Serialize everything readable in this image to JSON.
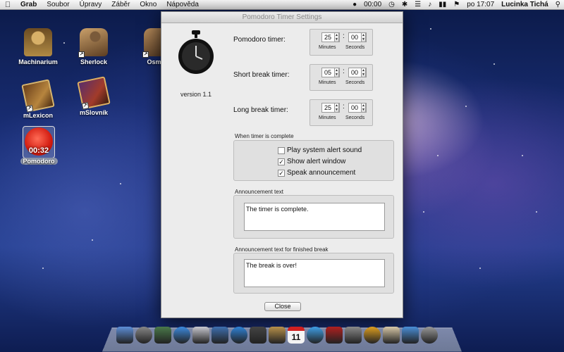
{
  "menubar": {
    "apple": "",
    "items": [
      "Grab",
      "Soubor",
      "Úpravy",
      "Záběr",
      "Okno",
      "Nápověda"
    ],
    "status_time": "00:00",
    "clock": "po 17:07",
    "user": "Lucinka Tichá"
  },
  "desktop_icons": [
    {
      "label": "Machinarium"
    },
    {
      "label": "Sherlock"
    },
    {
      "label": "Osmisr"
    },
    {
      "label": "mLexicon"
    },
    {
      "label": "mSlovník"
    },
    {
      "label": "Pomodoro",
      "overlay": "00:32"
    }
  ],
  "window": {
    "title": "Pomodoro Timer Settings",
    "version": "version 1.1",
    "timers": [
      {
        "label": "Pomodoro timer:",
        "minutes": "25",
        "seconds": "00"
      },
      {
        "label": "Short break timer:",
        "minutes": "05",
        "seconds": "00"
      },
      {
        "label": "Long break timer:",
        "minutes": "25",
        "seconds": "00"
      }
    ],
    "minutes_caption": "Minutes",
    "seconds_caption": "Seconds",
    "complete_group_title": "When timer is complete",
    "options": [
      {
        "label": "Play system alert sound",
        "checked": false
      },
      {
        "label": "Show alert window",
        "checked": true
      },
      {
        "label": "Speak announcement",
        "checked": true
      }
    ],
    "announcement_title": "Announcement text",
    "announcement_text": "The timer is complete.",
    "break_title": "Announcement text for finished break",
    "break_text": "The break is over!",
    "close_label": "Close"
  },
  "dock": {
    "icons": [
      "finder-icon",
      "rocket-icon",
      "photo-icon",
      "appstore-icon",
      "mail-icon",
      "preview-icon",
      "safari-icon",
      "camera-icon",
      "contacts-icon",
      "calendar-icon",
      "itunes-icon",
      "photobooth-icon",
      "preferences-icon",
      "chrome-icon",
      "documents-icon",
      "downloads-icon",
      "trash-icon"
    ],
    "colors": [
      "#5d8fd8",
      "#888888",
      "#4a7a4a",
      "#3d8be0",
      "#c8c8d0",
      "#3e6fb0",
      "#2f83d8",
      "#444444",
      "#b8914a",
      "#f4f4f4",
      "#3fa0e8",
      "#b02020",
      "#8a8a8a",
      "#e0a020",
      "#d8c8a8",
      "#4a8fd8",
      "#9a9a9a"
    ],
    "calendar_day": "11"
  }
}
